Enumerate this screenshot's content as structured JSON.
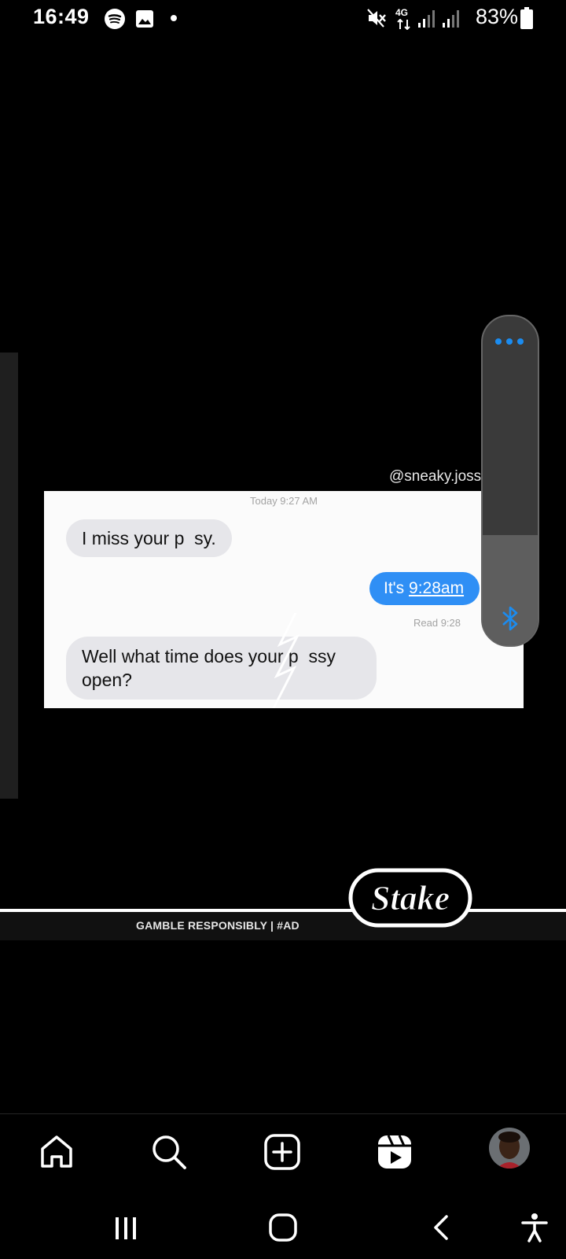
{
  "status_bar": {
    "time": "16:49",
    "network": "4G",
    "battery": "83%",
    "icons": [
      "spotify-icon",
      "gallery-icon",
      "notification-dot",
      "mute-icon",
      "4g-icon",
      "signal-icon",
      "signal-icon",
      "battery-icon"
    ]
  },
  "post": {
    "watermark": "@sneaky.joss",
    "screenshot": {
      "date": "Today 9:27 AM",
      "msg1": "I miss your p  sy.",
      "msg2_prefix": "It's ",
      "msg2_link": "9:28am",
      "read": "Read 9:28",
      "msg3": "Well what time does your p  ssy open?"
    }
  },
  "ad": {
    "gamble": "GAMBLE RESPONSIBLY  |  #AD",
    "logo": "Stake"
  },
  "colors": {
    "background": "#000000",
    "imessage_blue": "#2f8ff5",
    "incoming_bubble": "#e6e6ea",
    "panel_accent": "#1b8cf0"
  },
  "nav": {
    "items": [
      "home-icon",
      "search-icon",
      "create-icon",
      "reels-icon",
      "profile-avatar"
    ]
  },
  "system_nav": [
    "recents-button",
    "home-button",
    "back-button",
    "accessibility-button"
  ]
}
